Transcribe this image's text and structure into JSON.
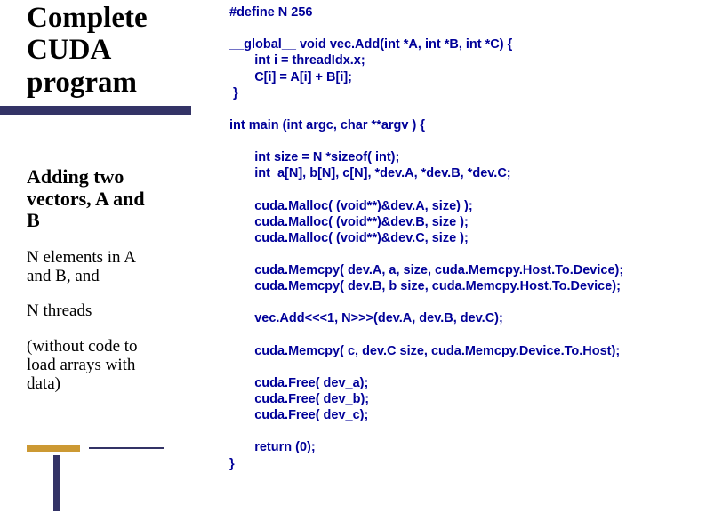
{
  "left": {
    "title_l1": "Complete",
    "title_l2": "CUDA",
    "title_l3": "program",
    "subhead_l1": "Adding two",
    "subhead_l2": "vectors, A and",
    "subhead_l3": "B",
    "p1_l1": "N elements in A",
    "p1_l2": "and B, and",
    "p2": "N threads",
    "p3_l1": "(without code to",
    "p3_l2": "load arrays with",
    "p3_l3": "data)"
  },
  "code": {
    "l01": "#define N 256",
    "l02": "",
    "l03": "__global__ void vec.Add(int *A, int *B, int *C) {",
    "l04": "       int i = threadIdx.x;",
    "l05": "       C[i] = A[i] + B[i];",
    "l06": " }",
    "l07": "",
    "l08": "int main (int argc, char **argv ) {",
    "l09": "",
    "l10": "       int size = N *sizeof( int);",
    "l11": "       int  a[N], b[N], c[N], *dev.A, *dev.B, *dev.C;",
    "l12": "",
    "l13": "       cuda.Malloc( (void**)&dev.A, size) );",
    "l14": "       cuda.Malloc( (void**)&dev.B, size );",
    "l15": "       cuda.Malloc( (void**)&dev.C, size );",
    "l16": "",
    "l17": "       cuda.Memcpy( dev.A, a, size, cuda.Memcpy.Host.To.Device);",
    "l18": "       cuda.Memcpy( dev.B, b size, cuda.Memcpy.Host.To.Device);",
    "l19": "",
    "l20": "       vec.Add<<<1, N>>>(dev.A, dev.B, dev.C);",
    "l21": "",
    "l22": "       cuda.Memcpy( c, dev.C size, cuda.Memcpy.Device.To.Host);",
    "l23": "",
    "l24": "       cuda.Free( dev_a);",
    "l25": "       cuda.Free( dev_b);",
    "l26": "       cuda.Free( dev_c);",
    "l27": "",
    "l28": "       return (0);",
    "l29": "}"
  }
}
